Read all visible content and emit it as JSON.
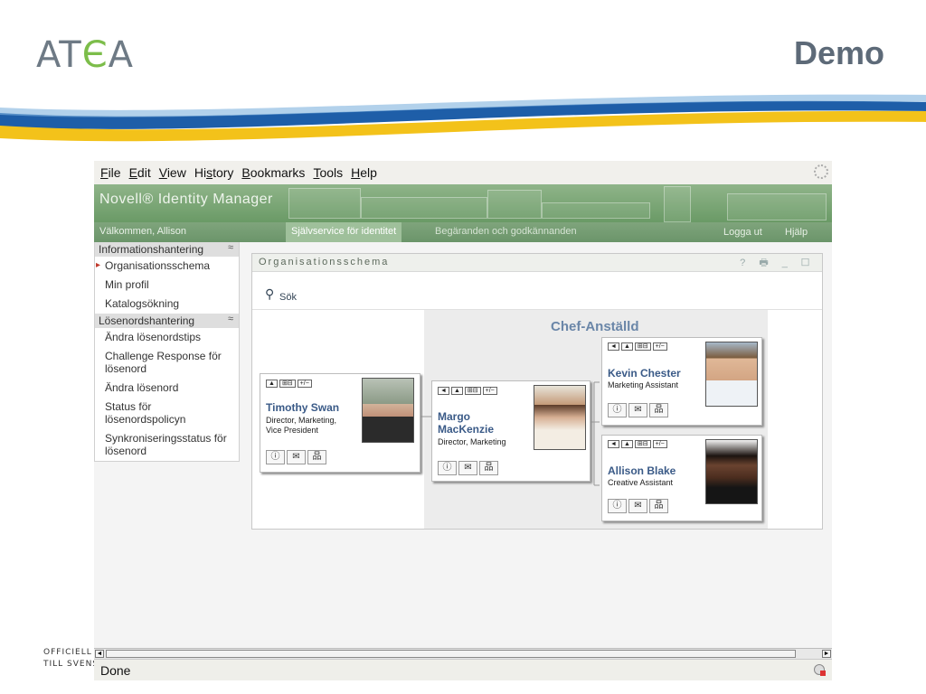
{
  "slide": {
    "logo_text_1": "AT",
    "logo_text_2": "Є",
    "logo_text_3": "A",
    "title": "Demo",
    "footer_line1": "OFFICIELL",
    "footer_line2": "TILL SVENS"
  },
  "menubar": {
    "items": [
      "File",
      "Edit",
      "View",
      "History",
      "Bookmarks",
      "Tools",
      "Help"
    ],
    "underline": [
      "F",
      "E",
      "V",
      "s",
      "B",
      "T",
      "H"
    ]
  },
  "banner": {
    "brand": "Novell® Identity Manager"
  },
  "navbar": {
    "welcome": "Välkommen, Allison",
    "tab_active": "Självservice för identitet",
    "tab_other": "Begäranden och godkännanden",
    "logout": "Logga ut",
    "help": "Hjälp"
  },
  "sidebar": {
    "section1": "Informationshantering",
    "items1": [
      "Organisationsschema",
      "Min profil",
      "Katalogsökning"
    ],
    "section2": "Lösenordshantering",
    "items2": [
      "Ändra lösenordstips",
      "Challenge Response för lösenord",
      "Ändra lösenord",
      "Status för lösenordspolicyn",
      "Synkroniseringsstatus för lösenord"
    ]
  },
  "portlet": {
    "title": "Organisationsschema",
    "controls": "? 🖶 _ ☐",
    "search_label": "Sök",
    "chart_heading": "Chef-Anställd"
  },
  "cards": {
    "timothy": {
      "name": "Timothy Swan",
      "title": "Director, Marketing, Vice President"
    },
    "margo": {
      "name_line1": "Margo",
      "name_line2": "MacKenzie",
      "title": "Director, Marketing"
    },
    "kevin": {
      "name": "Kevin Chester",
      "title": "Marketing Assistant"
    },
    "allison": {
      "name": "Allison Blake",
      "title": "Creative Assistant"
    }
  },
  "status": {
    "text": "Done"
  },
  "colors": {
    "accent_blue": "#3a5a87",
    "novell_green": "#7fa47c",
    "logo_green": "#7cbd4a"
  }
}
